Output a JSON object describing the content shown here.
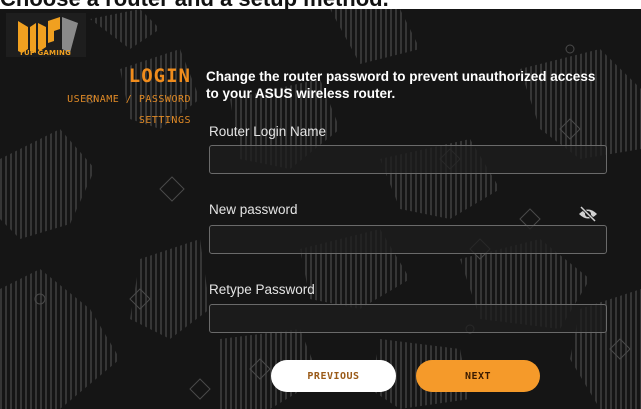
{
  "caption": "Choose a router and a setup method.",
  "brand": {
    "logo_text": "TUF GAMING"
  },
  "steps": {
    "current": "LOGIN",
    "sub_current": "USERNAME / PASSWORD",
    "next": "SETTINGS"
  },
  "form": {
    "heading": "Change the router password to prevent unauthorized access to your ASUS wireless router.",
    "login_name_label": "Router Login Name",
    "login_name_value": "",
    "new_password_label": "New password",
    "new_password_value": "",
    "retype_password_label": "Retype Password",
    "retype_password_value": ""
  },
  "buttons": {
    "previous": "PREVIOUS",
    "next": "NEXT"
  },
  "icons": {
    "password_toggle": "eye-slash-icon"
  },
  "colors": {
    "accent": "#f59a2a",
    "background": "#151515",
    "text": "#ffffff"
  }
}
